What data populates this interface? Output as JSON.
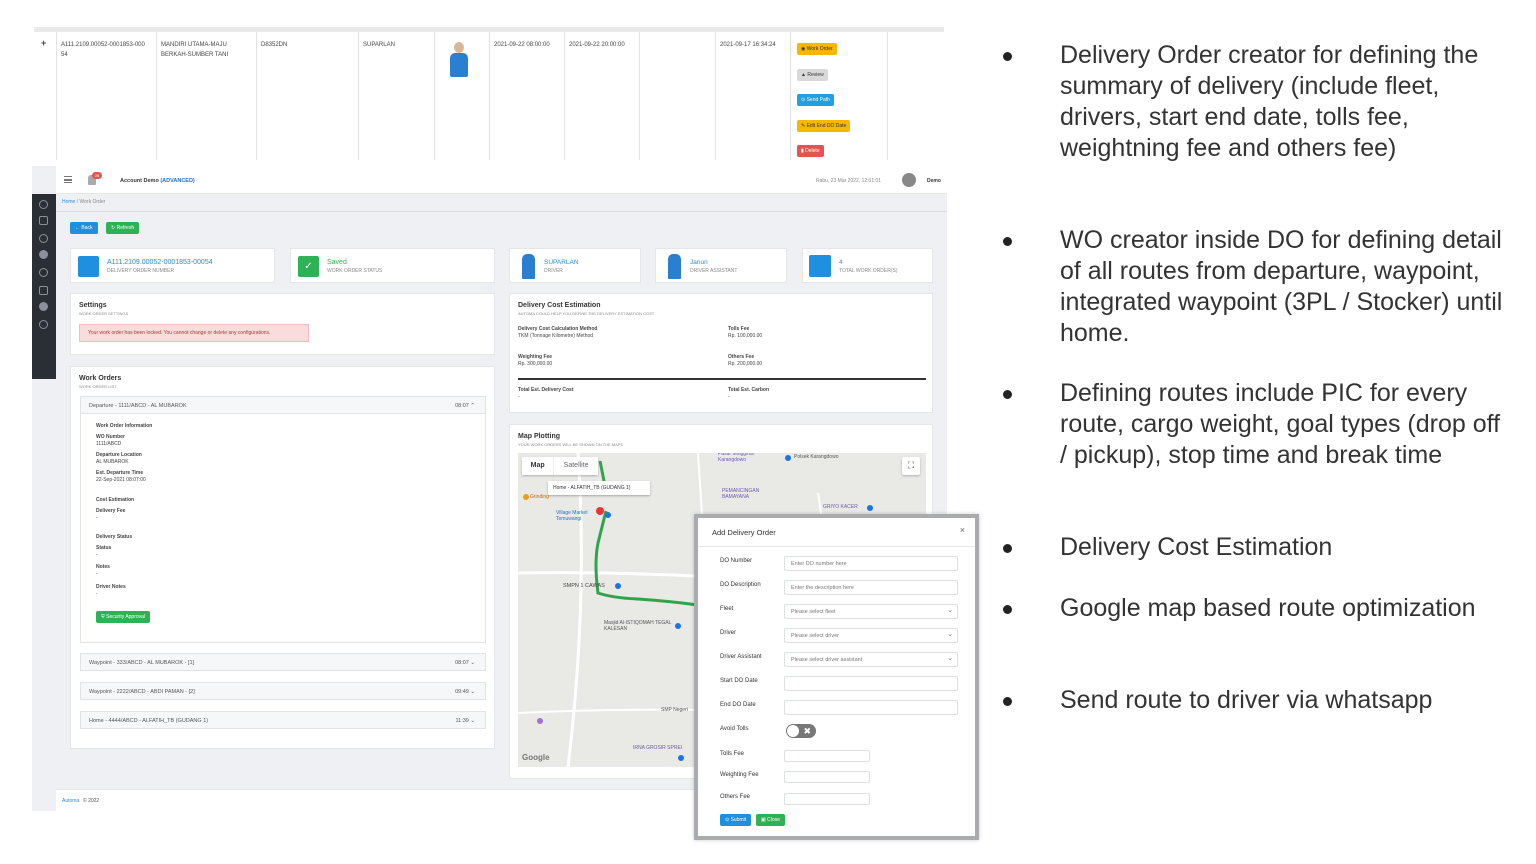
{
  "strip": {
    "expand": "+",
    "do_number": "A111.2109.00052-0001853-000 54",
    "company": "MANDIRI UTAMA-MAJU BERKAH-SUMBER TANI",
    "plate": "D8352DN",
    "driver": "SUPARLAN",
    "start": "2021-09-22 08:00:00",
    "end": "2021-09-22 20:00:00",
    "created": "2021-09-17 16:34:24",
    "buttons": {
      "work_order": "Work Order",
      "review": "Review",
      "send_path": "Send Path",
      "edit_end": "Edit End DO Date",
      "delete": "Delete"
    },
    "colors": {
      "warning": "#f5b800",
      "secondary": "#d9d9d9",
      "info": "#1fa0e3",
      "danger": "#e55353"
    }
  },
  "topbar": {
    "badge": "28",
    "account": "Account Demo",
    "account_tag": "(ADVANCED)",
    "datetime": "Rabu, 23 Mar 2022, 12:01:01",
    "user": "Demo"
  },
  "breadcrumb": {
    "home": "Home",
    "sep": "/",
    "current": "Work Order"
  },
  "actions": {
    "back": "Back",
    "refresh": "Refresh"
  },
  "info_cards": {
    "do_number": "A111.2109.00052-0001853-00054",
    "do_number_label": "DELIVERY ORDER NUMBER",
    "status": "Saved",
    "status_label": "WORK ORDER STATUS",
    "driver": "SUPARLAN",
    "driver_label": "DRIVER",
    "assistant": "Januri",
    "assistant_label": "DRIVER ASSISTANT",
    "total_wo": "4",
    "total_wo_label": "TOTAL WORK ORDER(S)"
  },
  "settings": {
    "title": "Settings",
    "subtitle": "WORK ORDER SETTINGS",
    "alert": "Your work order has been locked. You cannot change or delete any configurations."
  },
  "work_orders": {
    "title": "Work Orders",
    "subtitle": "WORK ORDER LIST",
    "items": [
      {
        "label": "Departure - 1111/ABCD - AL MUBAROK",
        "time": "08:07"
      },
      {
        "label": "Waypoint - 333/ABCD - AL MUBAROK - [1]",
        "time": "08:07"
      },
      {
        "label": "Waypoint - 2222/ABCD - ABDI PAMAN - [2]",
        "time": "09:49"
      },
      {
        "label": "Home - 4444/ABCD - ALFATIH_TB (GUDANG 1)",
        "time": "11:39"
      }
    ],
    "detail": {
      "info_title": "Work Order Information",
      "wo_number_label": "WO Number",
      "wo_number": "1111/ABCD",
      "departure_label": "Departure Location",
      "departure": "AL MUBAROK",
      "est_label": "Est. Departure Time",
      "est": "22-Sep-2021 08:07:00",
      "cost_title": "Cost Estimation",
      "delivery_fee_label": "Delivery Fee",
      "delivery_fee": "-",
      "delivery_status_title": "Delivery Status",
      "status_label": "Status",
      "status": "-",
      "notes_label": "Notes",
      "notes": "-",
      "driver_notes_label": "Driver Notes",
      "driver_notes": "-",
      "approval_button": "Security Approval"
    }
  },
  "cost": {
    "title": "Delivery Cost Estimation",
    "subtitle": "AUTOMA COULD HELP YOU DEFINE THE DELIVERY ESTIMATION COST",
    "method_label": "Delivery Cost Calculation Method",
    "method": "TKM (Tonnage Kilometre) Method",
    "tolls_label": "Tolls Fee",
    "tolls": "Rp. 100,000.00",
    "weighting_label": "Weighting Fee",
    "weighting": "Rp. 300,000.00",
    "others_label": "Others Fee",
    "others": "Rp. 200,000.00",
    "total_label": "Total Est. Delivery Cost",
    "total": "-",
    "carbon_label": "Total Est. Carbon",
    "carbon": "-"
  },
  "map": {
    "title": "Map Plotting",
    "subtitle": "YOUR WORK ORDERS WILL BE SHOWN ON THE MAPS",
    "tab_map": "Map",
    "tab_satellite": "Satellite",
    "labels": [
      "Pasar Minggiran Karangdowo",
      "Polsek Karangdowo",
      "Home - ALFATIH_TB (GUDANG 1)",
      "Grinding",
      "Village Market Temuwangi",
      "PEMANCINGAN BAMAYANA",
      "GRIYO KACER",
      "SMPN 1 CAWAS",
      "Masjid Al-ISTIQOMAH TEGAL KALESAN",
      "SMP Negeri",
      "IRNA GROSIR SPREI",
      "Google"
    ]
  },
  "footer": {
    "brand": "Automa",
    "year": "© 2022"
  },
  "modal": {
    "title": "Add Delivery Order",
    "close": "×",
    "fields": [
      {
        "label": "DO Number",
        "placeholder": "Enter DO number here"
      },
      {
        "label": "DO Description",
        "placeholder": "Enter the description here"
      },
      {
        "label": "Fleet",
        "placeholder": "Please select fleet"
      },
      {
        "label": "Driver",
        "placeholder": "Please select driver"
      },
      {
        "label": "Driver Assistant",
        "placeholder": "Please select driver assistant"
      },
      {
        "label": "Start DO Date",
        "placeholder": ""
      },
      {
        "label": "End DO Date",
        "placeholder": ""
      },
      {
        "label": "Avoid Tolls",
        "placeholder": ""
      },
      {
        "label": "Tolls Fee",
        "placeholder": ""
      },
      {
        "label": "Weighting Fee",
        "placeholder": ""
      },
      {
        "label": "Others Fee",
        "placeholder": ""
      }
    ],
    "submit": "Submit",
    "close_button": "Close"
  },
  "bullets": [
    "Delivery Order creator for defining the summary of delivery (include fleet, drivers, start end date, tolls fee, weightning fee and others fee)",
    "WO creator inside DO for defining detail of all routes from departure, waypoint, integrated waypoint (3PL / Stocker) until home.",
    "Defining routes include PIC for every route, cargo weight, goal types (drop off / pickup), stop time and break time",
    "Delivery Cost Estimation",
    "Google map based route optimization",
    "Send route to driver via whatsapp"
  ]
}
